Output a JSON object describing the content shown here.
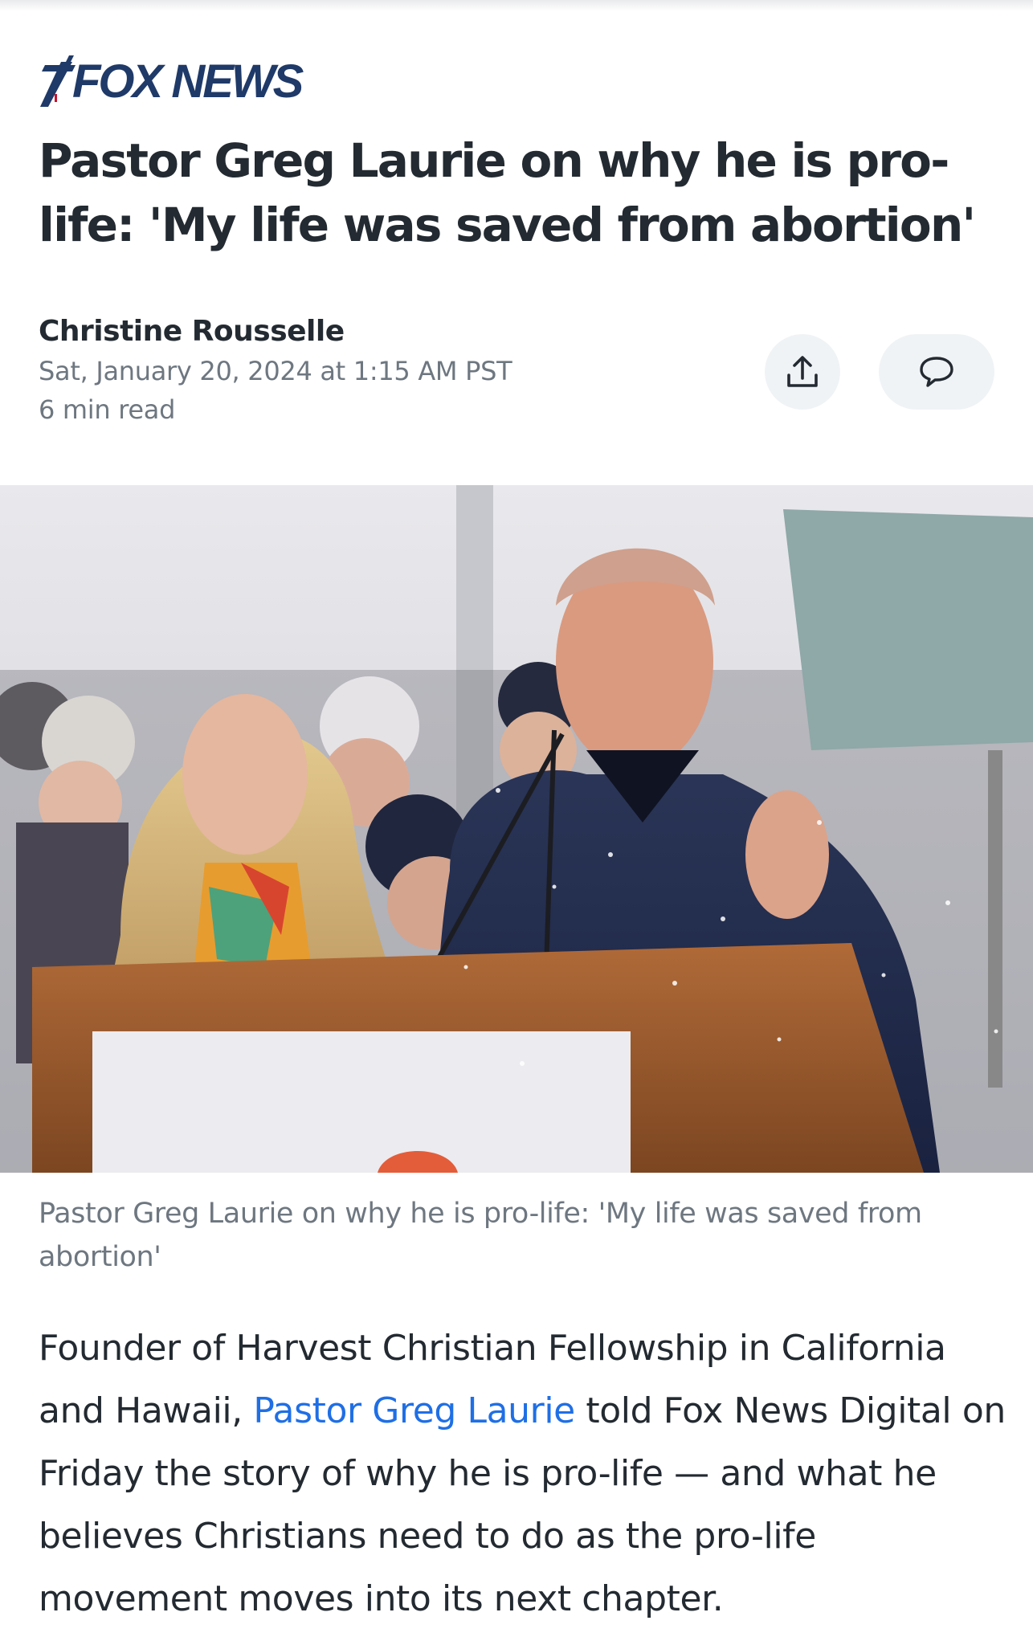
{
  "publisher": {
    "name": "FOX NEWS"
  },
  "article": {
    "headline": "Pastor Greg Laurie on why he is pro-life: 'My life was saved from abortion'",
    "author": "Christine Rousselle",
    "date": "Sat, January 20, 2024 at 1:15 AM PST",
    "read_time": "6 min read",
    "caption": "Pastor Greg Laurie on why he is pro-life: 'My life was saved from abortion'",
    "body": {
      "part1": "Founder of Harvest Christian Fellowship in California and Hawaii, ",
      "link_text": "Pastor Greg Laurie",
      "part2": " told Fox News Digital on Friday the story of why he is pro-life — and what he believes Christians need to do as the pro-life movement moves into its next chapter."
    }
  },
  "icons": {
    "share": "share-upload-icon",
    "comment": "comment-bubble-icon",
    "logo_mark": "fox-news-logo-mark"
  },
  "colors": {
    "text": "#232a31",
    "muted": "#6e7780",
    "link": "#1f6fe5",
    "button_bg": "#f0f3f5",
    "brand": "#1f3a68"
  }
}
